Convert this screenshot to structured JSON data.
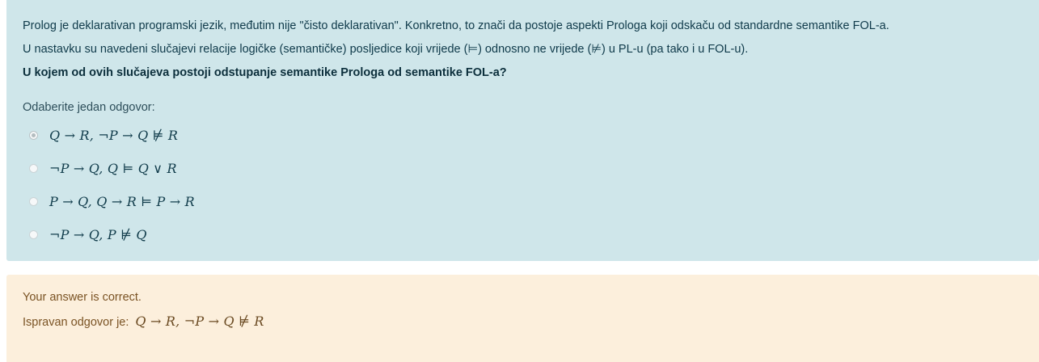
{
  "question": {
    "paragraphs": [
      "Prolog je deklarativan programski jezik, međutim nije \"čisto deklarativan\". Konkretno, to znači da postoje aspekti Prologa koji odskaču od standardne semantike FOL-a.",
      "U nastavku su navedeni slučajevi relacije logičke (semantičke) posljedice koji vrijede (⊨) odnosno ne vrijede (⊭) u PL-u (pa tako i u FOL-u).",
      "U kojem od ovih slučajeva postoji odstupanje semantike Prologa od semantike FOL-a?"
    ],
    "prompt": "Odaberite jedan odgovor:",
    "options": [
      {
        "label": "Q → R, ¬P → Q ⊭ R",
        "selected": true
      },
      {
        "label": "¬P → Q, Q ⊨ Q ∨ R",
        "selected": false
      },
      {
        "label": "P → Q, Q → R ⊨ P → R",
        "selected": false
      },
      {
        "label": "¬P → Q, P ⊭ Q",
        "selected": false
      }
    ]
  },
  "feedback": {
    "status": "Your answer is correct.",
    "correct_prefix": "Ispravan odgovor je:",
    "correct_answer": "Q → R, ¬P → Q ⊭ R"
  },
  "colors": {
    "question_bg": "#cfe6ea",
    "feedback_bg": "#fcefdc",
    "feedback_text": "#7a5324"
  }
}
